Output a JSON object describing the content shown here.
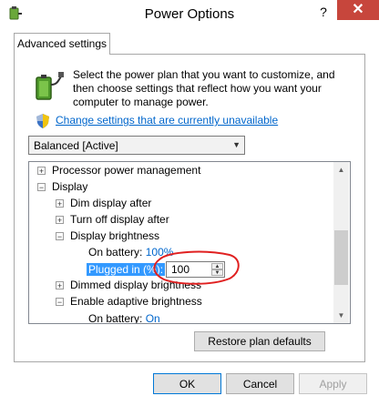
{
  "window": {
    "title": "Power Options",
    "help_glyph": "?",
    "close_glyph": "✕"
  },
  "tab": {
    "label": "Advanced settings"
  },
  "description": "Select the power plan that you want to customize, and then choose settings that reflect how you want your computer to manage power.",
  "change_link": "Change settings that are currently unavailable",
  "plan_select": {
    "value": "Balanced [Active]"
  },
  "tree": {
    "processor": "Processor power management",
    "display": "Display",
    "dim_display": "Dim display after",
    "turn_off_display": "Turn off display after",
    "display_brightness": "Display brightness",
    "on_battery_label": "On battery:",
    "on_battery_value": "100%",
    "plugged_in_label": "Plugged in (%):",
    "plugged_in_value": "100",
    "dimmed_brightness": "Dimmed display brightness",
    "adaptive_brightness": "Enable adaptive brightness",
    "adaptive_on_battery_label": "On battery:",
    "adaptive_on_battery_value": "On"
  },
  "buttons": {
    "restore": "Restore plan defaults",
    "ok": "OK",
    "cancel": "Cancel",
    "apply": "Apply"
  },
  "icons": {
    "app": "power-options-icon",
    "battery": "battery-plug-icon",
    "shield": "uac-shield-icon"
  },
  "colors": {
    "link": "#0066cc",
    "selection": "#3399ff",
    "close": "#c7463c",
    "annotation": "#e02020"
  }
}
